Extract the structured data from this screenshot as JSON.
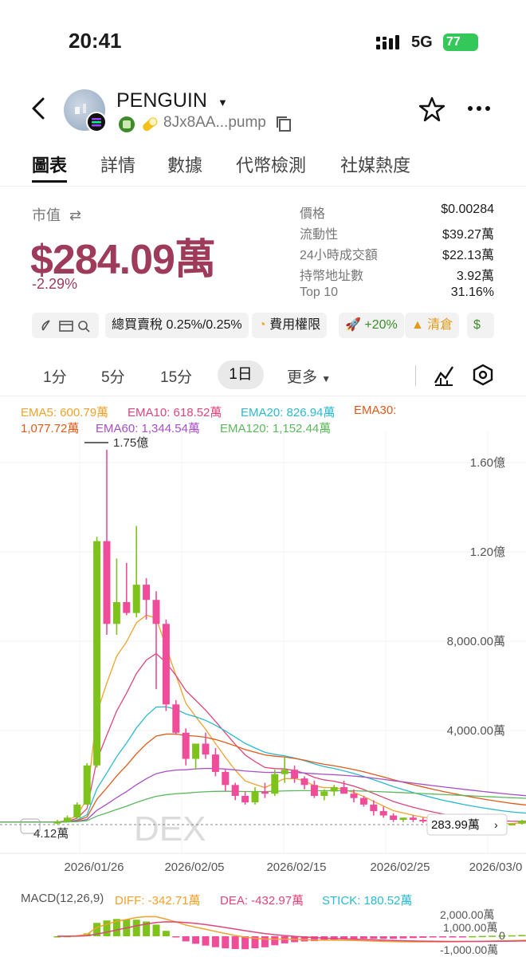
{
  "status_bar": {
    "time": "20:41",
    "network": "5G",
    "battery": "77"
  },
  "token": {
    "name": "PENGUIN",
    "address": "8Jx8AA...pump"
  },
  "tabs": [
    "圖表",
    "詳情",
    "數據",
    "代幣檢測",
    "社媒熱度"
  ],
  "market": {
    "label": "市值",
    "value": "$284.09萬",
    "change": "-2.29%",
    "stats": [
      {
        "label": "價格",
        "value": "$0.00284"
      },
      {
        "label": "流動性",
        "value": "$39.27萬"
      },
      {
        "label": "24小時成交額",
        "value": "$22.13萬"
      },
      {
        "label": "持幣地址數",
        "value": "3.92萬"
      },
      {
        "label": "Top 10",
        "value": "31.16%"
      }
    ]
  },
  "chips": {
    "tax": "總買賣稅 0.25%/0.25%",
    "fee": "費用權限",
    "boost": "+20%",
    "clear": "清倉"
  },
  "timeframes": [
    "1分",
    "5分",
    "15分",
    "1日"
  ],
  "timeframe_active": "1日",
  "more_label": "更多",
  "ema": {
    "ema5": "EMA5: 600.79萬",
    "ema10": "EMA10: 618.52萬",
    "ema20": "EMA20: 826.94萬",
    "ema30": "EMA30:",
    "ema30_value": "1,077.72萬",
    "ema60": "EMA60: 1,344.54萬",
    "ema120": "EMA120: 1,152.44萬"
  },
  "colors": {
    "up": "#7ec31b",
    "down": "#ef4c9a",
    "accent": "#9e3a5a",
    "ema5": "#f0a22b",
    "ema10": "#e0457a",
    "ema20": "#2bbad0",
    "ema30": "#e05a1a",
    "ema60": "#a64fc7",
    "ema120": "#5cb85c"
  },
  "chart_data": {
    "type": "candlestick",
    "y_labels": [
      "1.60億",
      "1.20億",
      "8,000.00萬",
      "4,000.00萬"
    ],
    "x_labels": [
      "2026/01/26",
      "2026/02/05",
      "2026/02/15",
      "2026/02/25",
      "2026/03/0"
    ],
    "max_label": "1.75億",
    "min_label": "4.12萬",
    "last_price_label": "283.99萬",
    "watermark": "DEX",
    "candles": [
      [
        4,
        5,
        3,
        4
      ],
      [
        4,
        7,
        4,
        6
      ],
      [
        6,
        13,
        6,
        12
      ],
      [
        12,
        31,
        12,
        30
      ],
      [
        30,
        135,
        29,
        133
      ],
      [
        133,
        175,
        90,
        95
      ],
      [
        95,
        125,
        90,
        105
      ],
      [
        105,
        123,
        99,
        100
      ],
      [
        100,
        140,
        98,
        113
      ],
      [
        113,
        116,
        97,
        106
      ],
      [
        106,
        110,
        65,
        95
      ],
      [
        95,
        97,
        55,
        58
      ],
      [
        58,
        60,
        44,
        45
      ],
      [
        45,
        47,
        30,
        33
      ],
      [
        33,
        40,
        28,
        40
      ],
      [
        40,
        45,
        33,
        35
      ],
      [
        35,
        38,
        25,
        27
      ],
      [
        27,
        28,
        18,
        21
      ],
      [
        21,
        22,
        14,
        16
      ],
      [
        16,
        18,
        12,
        13
      ],
      [
        13,
        20,
        12,
        18
      ],
      [
        18,
        22,
        15,
        17
      ],
      [
        17,
        28,
        16,
        26
      ],
      [
        26,
        34,
        22,
        28
      ],
      [
        28,
        30,
        22,
        24
      ],
      [
        24,
        25,
        19,
        21
      ],
      [
        21,
        23,
        15,
        16
      ],
      [
        16,
        19,
        14,
        18
      ],
      [
        18,
        21,
        16,
        20
      ],
      [
        20,
        23,
        18,
        17
      ],
      [
        17,
        19,
        13,
        15
      ],
      [
        15,
        16,
        11,
        12
      ],
      [
        12,
        14,
        7,
        9
      ],
      [
        9,
        11,
        6,
        7
      ],
      [
        7,
        8,
        4,
        5
      ],
      [
        5,
        6,
        4,
        6
      ],
      [
        6,
        7,
        4,
        5
      ],
      [
        5,
        6,
        3.5,
        4.5
      ],
      [
        4.5,
        5,
        3.5,
        4
      ],
      [
        4,
        5,
        3,
        3.5
      ],
      [
        3.5,
        4.5,
        3,
        4
      ],
      [
        4,
        4.5,
        3,
        3.2
      ],
      [
        3.2,
        4,
        2.6,
        3.5
      ],
      [
        3.5,
        4,
        2.6,
        3
      ],
      [
        3,
        3.6,
        2.4,
        3.3
      ],
      [
        3.3,
        3.5,
        2.6,
        2.9
      ],
      [
        2.9,
        3.4,
        2.5,
        3.2
      ],
      [
        3.2,
        5,
        2.8,
        4.6
      ],
      [
        4.6,
        5.2,
        3.5,
        4
      ],
      [
        4,
        4.2,
        2.8,
        3
      ]
    ],
    "units": "百萬 (1e6)"
  },
  "macd": {
    "label": "MACD(12,26,9)",
    "diff": "DIFF: -342.71萬",
    "dea": "DEA: -432.97萬",
    "stick": "STICK: 180.52萬",
    "y_labels": [
      "2,000.00萬",
      "1,000.00萬",
      "0",
      "-1,000.00萬"
    ]
  }
}
